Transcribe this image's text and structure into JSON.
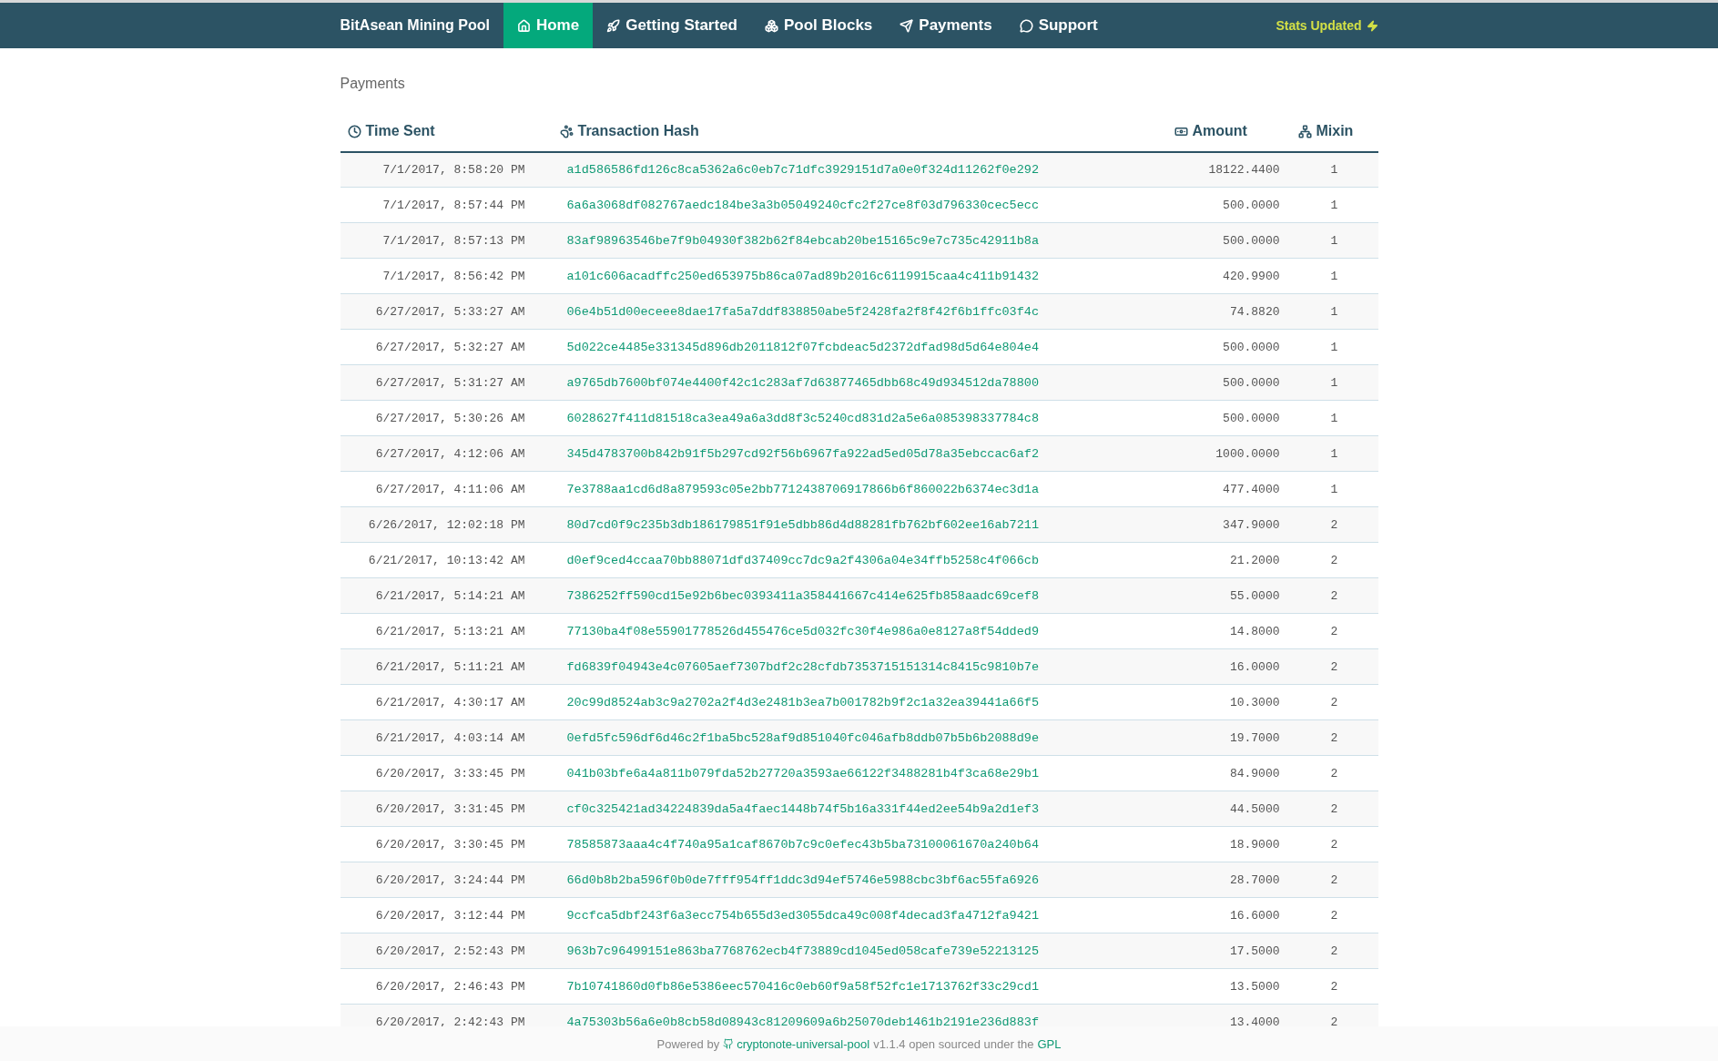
{
  "navbar": {
    "brand": "BitAsean Mining Pool",
    "items": [
      {
        "label": "Home",
        "selected": true
      },
      {
        "label": "Getting Started",
        "selected": false
      },
      {
        "label": "Pool Blocks",
        "selected": false
      },
      {
        "label": "Payments",
        "selected": false
      },
      {
        "label": "Support",
        "selected": false
      }
    ],
    "status": "Stats Updated"
  },
  "page_title": "Payments",
  "table": {
    "columns": [
      {
        "label": "Time Sent"
      },
      {
        "label": "Transaction Hash"
      },
      {
        "label": "Amount"
      },
      {
        "label": "Mixin"
      }
    ],
    "rows": [
      {
        "time": "7/1/2017, 8:58:20 PM",
        "hash": "a1d586586fd126c8ca5362a6c0eb7c71dfc3929151d7a0e0f324d11262f0e292",
        "amount": "18122.4400",
        "mixin": "1"
      },
      {
        "time": "7/1/2017, 8:57:44 PM",
        "hash": "6a6a3068df082767aedc184be3a3b05049240cfc2f27ce8f03d796330cec5ecc",
        "amount": "500.0000",
        "mixin": "1"
      },
      {
        "time": "7/1/2017, 8:57:13 PM",
        "hash": "83af98963546be7f9b04930f382b62f84ebcab20be15165c9e7c735c42911b8a",
        "amount": "500.0000",
        "mixin": "1"
      },
      {
        "time": "7/1/2017, 8:56:42 PM",
        "hash": "a101c606acadffc250ed653975b86ca07ad89b2016c6119915caa4c411b91432",
        "amount": "420.9900",
        "mixin": "1"
      },
      {
        "time": "6/27/2017, 5:33:27 AM",
        "hash": "06e4b51d00eceee8dae17fa5a7ddf838850abe5f2428fa2f8f42f6b1ffc03f4c",
        "amount": "74.8820",
        "mixin": "1"
      },
      {
        "time": "6/27/2017, 5:32:27 AM",
        "hash": "5d022ce4485e331345d896db2011812f07fcbdeac5d2372dfad98d5d64e804e4",
        "amount": "500.0000",
        "mixin": "1"
      },
      {
        "time": "6/27/2017, 5:31:27 AM",
        "hash": "a9765db7600bf074e4400f42c1c283af7d63877465dbb68c49d934512da78800",
        "amount": "500.0000",
        "mixin": "1"
      },
      {
        "time": "6/27/2017, 5:30:26 AM",
        "hash": "6028627f411d81518ca3ea49a6a3dd8f3c5240cd831d2a5e6a085398337784c8",
        "amount": "500.0000",
        "mixin": "1"
      },
      {
        "time": "6/27/2017, 4:12:06 AM",
        "hash": "345d4783700b842b91f5b297cd92f56b6967fa922ad5ed05d78a35ebccac6af2",
        "amount": "1000.0000",
        "mixin": "1"
      },
      {
        "time": "6/27/2017, 4:11:06 AM",
        "hash": "7e3788aa1cd6d8a879593c05e2bb7712438706917866b6f860022b6374ec3d1a",
        "amount": "477.4000",
        "mixin": "1"
      },
      {
        "time": "6/26/2017, 12:02:18 PM",
        "hash": "80d7cd0f9c235b3db186179851f91e5dbb86d4d88281fb762bf602ee16ab7211",
        "amount": "347.9000",
        "mixin": "2"
      },
      {
        "time": "6/21/2017, 10:13:42 AM",
        "hash": "d0ef9ced4ccaa70bb88071dfd37409cc7dc9a2f4306a04e34ffb5258c4f066cb",
        "amount": "21.2000",
        "mixin": "2"
      },
      {
        "time": "6/21/2017, 5:14:21 AM",
        "hash": "7386252ff590cd15e92b6bec0393411a358441667c414e625fb858aadc69cef8",
        "amount": "55.0000",
        "mixin": "2"
      },
      {
        "time": "6/21/2017, 5:13:21 AM",
        "hash": "77130ba4f08e55901778526d455476ce5d032fc30f4e986a0e8127a8f54dded9",
        "amount": "14.8000",
        "mixin": "2"
      },
      {
        "time": "6/21/2017, 5:11:21 AM",
        "hash": "fd6839f04943e4c07605aef7307bdf2c28cfdb7353715151314c8415c9810b7e",
        "amount": "16.0000",
        "mixin": "2"
      },
      {
        "time": "6/21/2017, 4:30:17 AM",
        "hash": "20c99d8524ab3c9a2702a2f4d3e2481b3ea7b001782b9f2c1a32ea39441a66f5",
        "amount": "10.3000",
        "mixin": "2"
      },
      {
        "time": "6/21/2017, 4:03:14 AM",
        "hash": "0efd5fc596df6d46c2f1ba5bc528af9d851040fc046afb8ddb07b5b6b2088d9e",
        "amount": "19.7000",
        "mixin": "2"
      },
      {
        "time": "6/20/2017, 3:33:45 PM",
        "hash": "041b03bfe6a4a811b079fda52b27720a3593ae66122f3488281b4f3ca68e29b1",
        "amount": "84.9000",
        "mixin": "2"
      },
      {
        "time": "6/20/2017, 3:31:45 PM",
        "hash": "cf0c325421ad34224839da5a4faec1448b74f5b16a331f44ed2ee54b9a2d1ef3",
        "amount": "44.5000",
        "mixin": "2"
      },
      {
        "time": "6/20/2017, 3:30:45 PM",
        "hash": "78585873aaa4c4f740a95a1caf8670b7c9c0efec43b5ba73100061670a240b64",
        "amount": "18.9000",
        "mixin": "2"
      },
      {
        "time": "6/20/2017, 3:24:44 PM",
        "hash": "66d0b8b2ba596f0b0de7fff954ff1ddc3d94ef5746e5988cbc3bf6ac55fa6926",
        "amount": "28.7000",
        "mixin": "2"
      },
      {
        "time": "6/20/2017, 3:12:44 PM",
        "hash": "9ccfca5dbf243f6a3ecc754b655d3ed3055dca49c008f4decad3fa4712fa9421",
        "amount": "16.6000",
        "mixin": "2"
      },
      {
        "time": "6/20/2017, 2:52:43 PM",
        "hash": "963b7c96499151e863ba7768762ecb4f73889cd1045ed058cafe739e52213125",
        "amount": "17.5000",
        "mixin": "2"
      },
      {
        "time": "6/20/2017, 2:46:43 PM",
        "hash": "7b10741860d0fb86e5386eec570416c0eb60f9a58f52fc1e1713762f33c29cd1",
        "amount": "13.5000",
        "mixin": "2"
      },
      {
        "time": "6/20/2017, 2:42:43 PM",
        "hash": "4a75303b56a6e0b8cb58d08943c81209609a6b25070deb1461b2191e236d883f",
        "amount": "13.4000",
        "mixin": "2"
      }
    ]
  },
  "footer": {
    "prefix": "Powered by",
    "link": "cryptonote-universal-pool",
    "middle": "v1.1.4 open sourced under the",
    "license": "GPL"
  }
}
